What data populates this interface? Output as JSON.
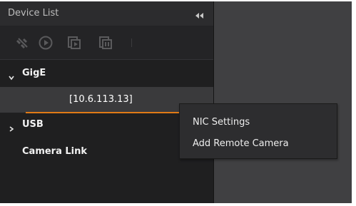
{
  "panel": {
    "title": "Device List"
  },
  "toolbar": {
    "icons": [
      "disconnect-icon",
      "play-icon",
      "grab-start-icon",
      "grab-stop-icon"
    ]
  },
  "tree": {
    "gige": {
      "label": "GigE",
      "expanded": true
    },
    "device": {
      "label": "[10.6.113.13]"
    },
    "usb": {
      "label": "USB",
      "expanded": false
    },
    "camera_link": {
      "label": "Camera Link"
    }
  },
  "context_menu": {
    "items": [
      "NIC Settings",
      "Add Remote Camera"
    ]
  },
  "colors": {
    "accent": "#e07a16",
    "panel_bg": "#1f1f20",
    "workspace_bg": "#404042",
    "menu_bg": "#2d2d2f"
  }
}
